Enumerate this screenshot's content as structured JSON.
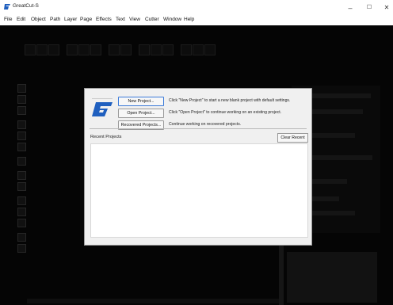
{
  "window": {
    "title": "GreatCut-S",
    "minimize_glyph": "–",
    "maximize_glyph": "☐",
    "close_glyph": "✕"
  },
  "menu": [
    "File",
    "Edit",
    "Object",
    "Path",
    "Layer",
    "Page",
    "Effects",
    "Text",
    "View",
    "Cutter",
    "Window",
    "Help"
  ],
  "dialog": {
    "buttons": {
      "new_project": "New Project...",
      "open_project": "Open Project...",
      "recovered_projects": "Recovered Projects..."
    },
    "descriptions": {
      "new_project": "Click \"New Project\" to start a new blank project with default settings.",
      "open_project": "Click \"Open Project\" to continue working on an existing project.",
      "recovered_projects": "Continue working on recovered projects."
    },
    "recent_projects_label": "Recent Projects",
    "clear_recent_label": "Clear Recent",
    "recent_projects": []
  },
  "colors": {
    "accent": "#3b7ad8",
    "logo_blue": "#1f5fbf",
    "workspace": "#050505"
  },
  "icons": {
    "app": "greatcut-logo-icon"
  }
}
